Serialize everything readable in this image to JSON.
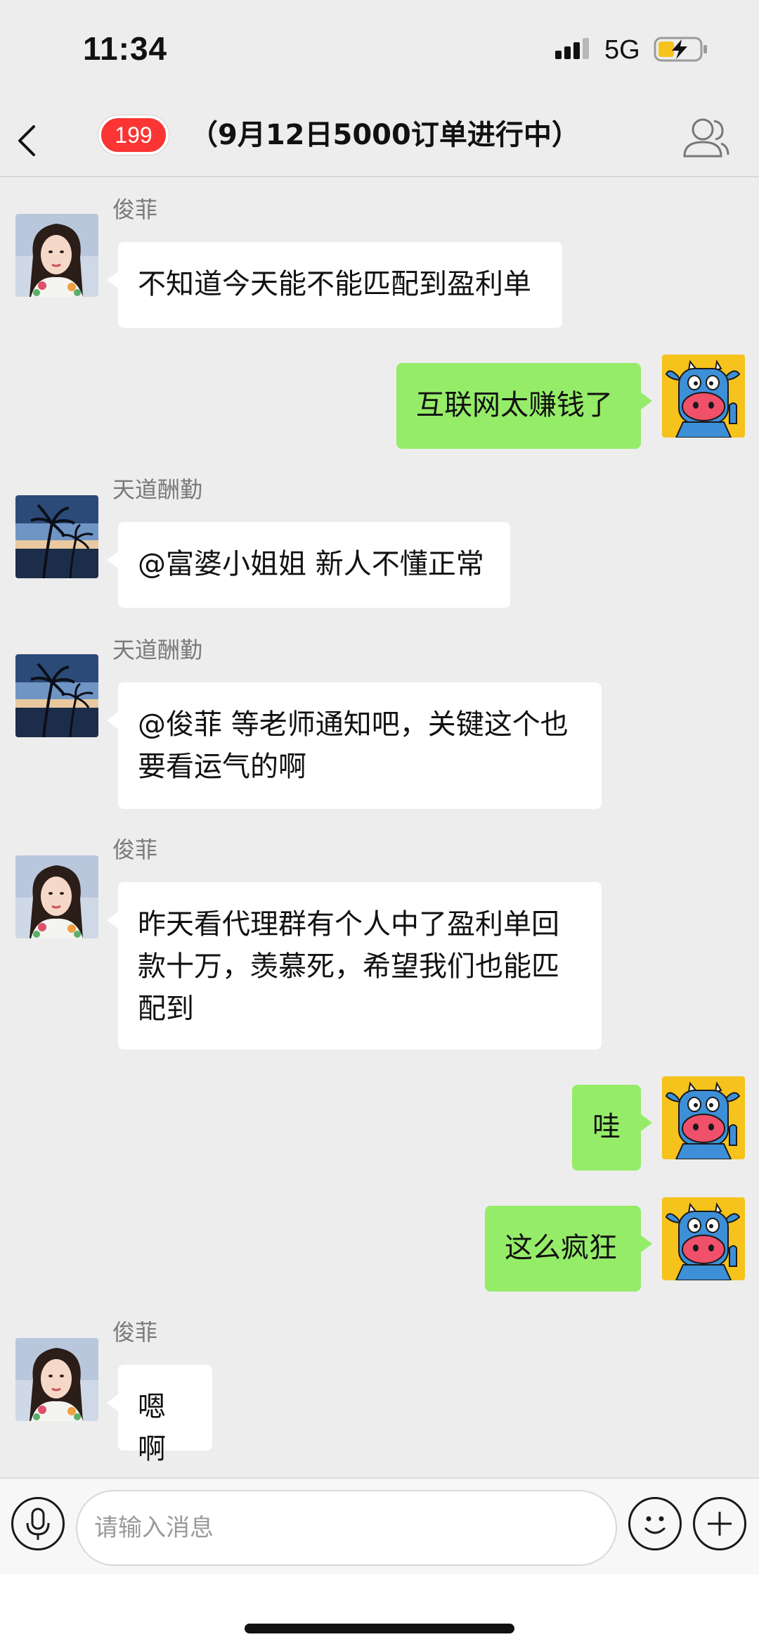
{
  "status_bar": {
    "time": "11:34",
    "network": "5G",
    "signal_icon": "cellular-signal-icon",
    "battery_icon": "battery-charging-icon"
  },
  "nav": {
    "back_icon": "chevron-left-icon",
    "badge_count": "199",
    "title": "（9月12日5000订单进行中）",
    "group_icon": "group-members-icon"
  },
  "messages": [
    {
      "side": "left",
      "sender": "俊菲",
      "avatar": "woman-avatar",
      "text": "不知道今天能不能匹配到盈利单"
    },
    {
      "side": "right",
      "avatar": "cartoon-cow-avatar",
      "text": "互联网太赚钱了"
    },
    {
      "side": "left",
      "sender": "天道酬勤",
      "avatar": "palm-tree-sunset-avatar",
      "text": "@富婆小姐姐 新人不懂正常"
    },
    {
      "side": "left",
      "sender": "天道酬勤",
      "avatar": "palm-tree-sunset-avatar",
      "text_lines": [
        "@俊菲 等老师通知吧，关键这个也",
        "要看运气的啊"
      ]
    },
    {
      "side": "left",
      "sender": "俊菲",
      "avatar": "woman-avatar",
      "text_lines": [
        "昨天看代理群有个人中了盈利单回",
        "款十万，羡慕死，希望我们也能匹",
        "配到"
      ]
    },
    {
      "side": "right",
      "avatar": "cartoon-cow-avatar",
      "text": "哇"
    },
    {
      "side": "right",
      "avatar": "cartoon-cow-avatar",
      "text": "这么疯狂"
    },
    {
      "side": "left",
      "sender": "俊菲",
      "avatar": "woman-avatar",
      "text": "嗯啊"
    }
  ],
  "input_bar": {
    "voice_icon": "microphone-icon",
    "placeholder": "请输入消息",
    "emoji_icon": "smiley-icon",
    "plus_icon": "plus-icon"
  },
  "colors": {
    "background": "#ededed",
    "own_bubble": "#95ec69",
    "other_bubble": "#ffffff",
    "badge": "#fa3534"
  }
}
